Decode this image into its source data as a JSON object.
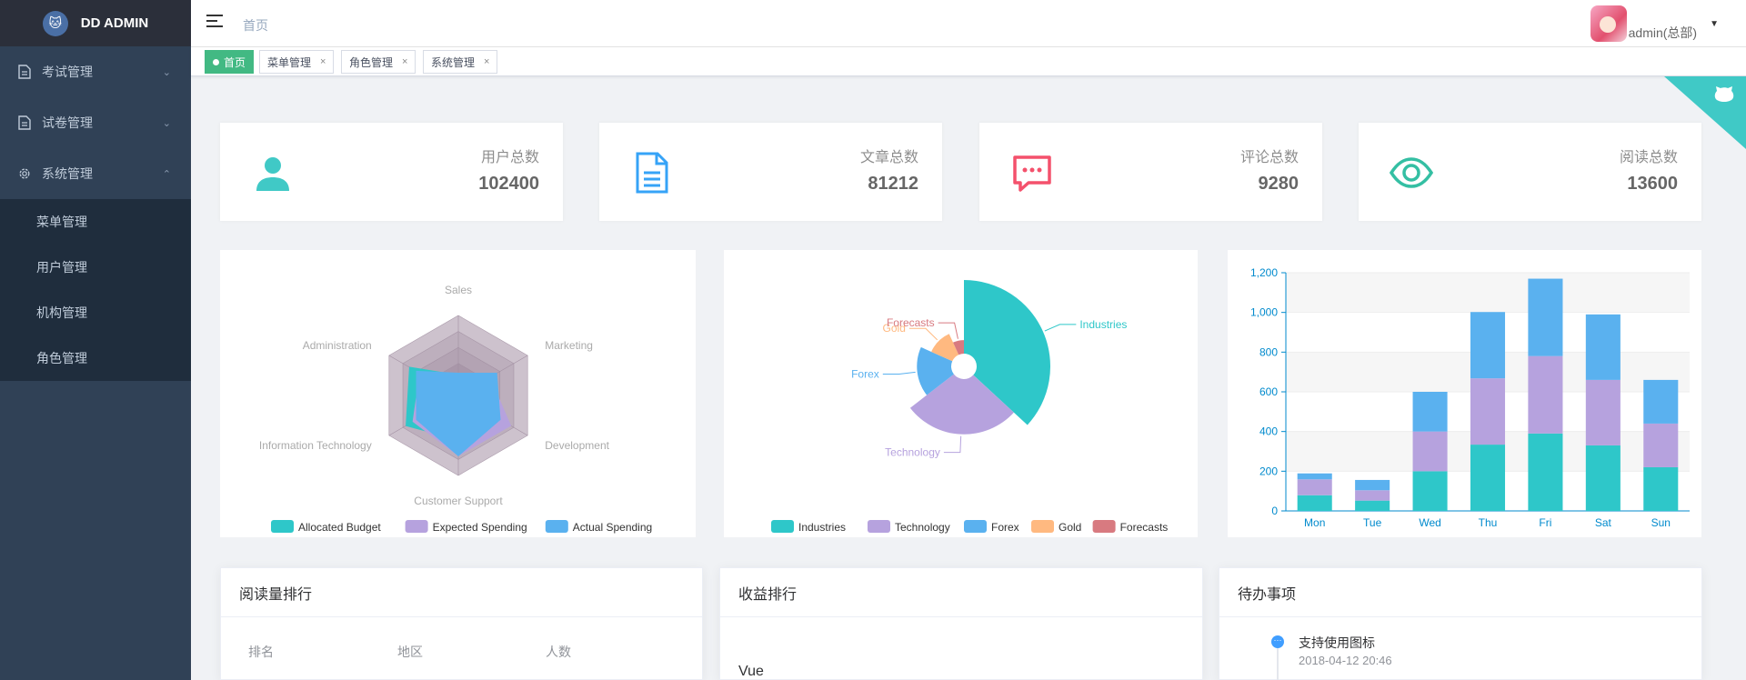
{
  "sidebar": {
    "logo_text": "DD ADMIN",
    "menus": [
      {
        "label": "考试管理",
        "icon": "document-icon",
        "arrow": "down"
      },
      {
        "label": "试卷管理",
        "icon": "document-icon",
        "arrow": "down"
      },
      {
        "label": "系统管理",
        "icon": "gear-icon",
        "arrow": "up"
      }
    ],
    "submenu": [
      "菜单管理",
      "用户管理",
      "机构管理",
      "角色管理"
    ]
  },
  "header": {
    "breadcrumb": "首页",
    "username": "admin(总部)"
  },
  "tags": [
    {
      "label": "首页",
      "active": true
    },
    {
      "label": "菜单管理",
      "active": false
    },
    {
      "label": "角色管理",
      "active": false
    },
    {
      "label": "系统管理",
      "active": false
    }
  ],
  "panels": [
    {
      "label": "用户总数",
      "value": "102400",
      "icon": "user-icon",
      "color": "#40c9c6"
    },
    {
      "label": "文章总数",
      "value": "81212",
      "icon": "document-icon",
      "color": "#36a3f7"
    },
    {
      "label": "评论总数",
      "value": "9280",
      "icon": "message-icon",
      "color": "#f4516c"
    },
    {
      "label": "阅读总数",
      "value": "13600",
      "icon": "eye-icon",
      "color": "#34bfa3"
    }
  ],
  "bottom_cards": {
    "reading_rank": {
      "title": "阅读量排行",
      "columns": [
        "排名",
        "地区",
        "人数"
      ]
    },
    "income_rank": {
      "title": "收益排行",
      "first_item": "Vue"
    },
    "todo": {
      "title": "待办事项",
      "items": [
        {
          "text": "支持使用图标",
          "time": "2018-04-12 20:46"
        }
      ]
    }
  },
  "chart_data": [
    {
      "type": "radar",
      "indicators": [
        "Sales",
        "Marketing",
        "Development",
        "Customer Support",
        "Information Technology",
        "Administration"
      ],
      "max": 20000,
      "series": [
        {
          "name": "Allocated Budget",
          "color": "#2ec7c9",
          "values": [
            5000,
            7000,
            12000,
            11000,
            15000,
            14000
          ]
        },
        {
          "name": "Expected Spending",
          "color": "#b6a2de",
          "values": [
            4000,
            9000,
            15000,
            15000,
            13000,
            11000
          ]
        },
        {
          "name": "Actual Spending",
          "color": "#5ab1ef",
          "values": [
            5500,
            11000,
            12000,
            15000,
            12000,
            12000
          ]
        }
      ]
    },
    {
      "type": "pie",
      "subtype": "rose",
      "categories": [
        "Industries",
        "Technology",
        "Forex",
        "Gold",
        "Forecasts"
      ],
      "values": [
        320,
        240,
        149,
        100,
        59
      ],
      "colors": [
        "#2ec7c9",
        "#b6a2de",
        "#5ab1ef",
        "#ffb980",
        "#d87a80"
      ]
    },
    {
      "type": "bar",
      "stacked": true,
      "categories": [
        "Mon",
        "Tue",
        "Wed",
        "Thu",
        "Fri",
        "Sat",
        "Sun"
      ],
      "series": [
        {
          "color": "#2ec7c9",
          "values": [
            79,
            52,
            200,
            334,
            390,
            330,
            220
          ]
        },
        {
          "color": "#b6a2de",
          "values": [
            80,
            52,
            200,
            334,
            390,
            330,
            220
          ]
        },
        {
          "color": "#5ab1ef",
          "values": [
            30,
            52,
            200,
            334,
            390,
            330,
            220
          ]
        }
      ],
      "ylim": [
        0,
        1200
      ],
      "yticks": [
        "0",
        "200",
        "400",
        "600",
        "800",
        "1,000",
        "1,200"
      ],
      "grid": true
    }
  ]
}
